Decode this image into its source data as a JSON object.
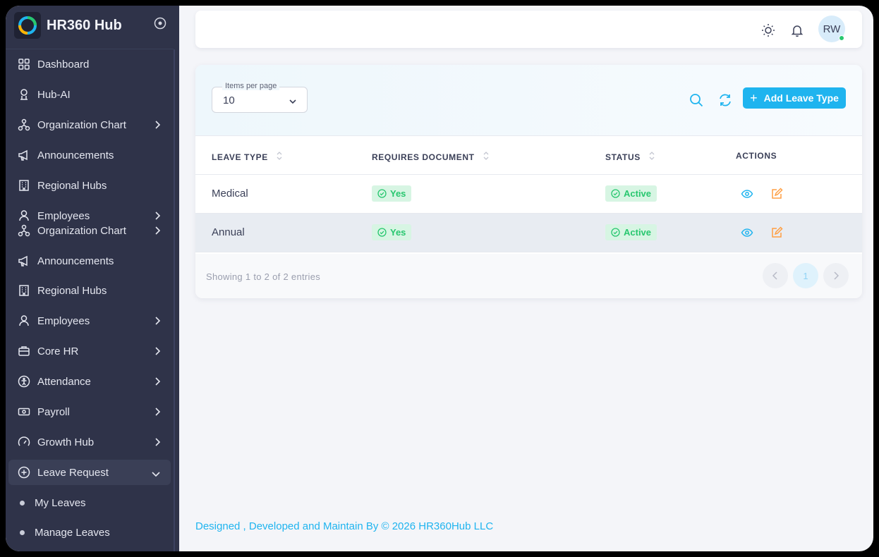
{
  "brand": {
    "name": "HR360 Hub"
  },
  "sidebar": {
    "items": [
      {
        "label": "Dashboard",
        "icon": "dashboard-icon"
      },
      {
        "label": "Hub-AI",
        "icon": "robot-icon"
      },
      {
        "label": "Organization Chart",
        "icon": "org-chart-icon",
        "chevron": "right"
      },
      {
        "label": "Announcements",
        "icon": "megaphone-icon"
      },
      {
        "label": "Regional Hubs",
        "icon": "building-icon"
      },
      {
        "label": "Employees",
        "icon": "user-icon",
        "chevron": "right"
      },
      {
        "label": "Organization Chart",
        "icon": "org-chart-icon",
        "chevron": "right"
      },
      {
        "label": "Announcements",
        "icon": "megaphone-icon"
      },
      {
        "label": "Regional Hubs",
        "icon": "building-icon"
      },
      {
        "label": "Employees",
        "icon": "user-icon",
        "chevron": "right"
      },
      {
        "label": "Core HR",
        "icon": "briefcase-icon",
        "chevron": "right"
      },
      {
        "label": "Attendance",
        "icon": "accessibility-icon",
        "chevron": "right"
      },
      {
        "label": "Payroll",
        "icon": "cash-icon",
        "chevron": "right"
      },
      {
        "label": "Growth Hub",
        "icon": "gauge-icon",
        "chevron": "right"
      },
      {
        "label": "Leave Request",
        "icon": "plus-circle-icon",
        "chevron": "down",
        "active": true
      }
    ],
    "subitems": [
      {
        "label": "My Leaves"
      },
      {
        "label": "Manage Leaves"
      }
    ]
  },
  "topbar": {
    "avatar_initials": "RW"
  },
  "toolbar": {
    "items_per_page_label": "Items per page",
    "items_per_page_value": "10",
    "add_button_label": "Add Leave Type"
  },
  "table": {
    "columns": [
      "LEAVE TYPE",
      "REQUIRES DOCUMENT",
      "STATUS",
      "ACTIONS"
    ],
    "rows": [
      {
        "leave_type": "Medical",
        "requires_document": "Yes",
        "status": "Active"
      },
      {
        "leave_type": "Annual",
        "requires_document": "Yes",
        "status": "Active"
      }
    ]
  },
  "pagination": {
    "summary": "Showing 1 to 2 of 2 entries",
    "current_page": "1"
  },
  "footer": {
    "copyright": "Designed , Developed and Maintain By © 2026 HR360Hub LLC"
  },
  "colors": {
    "accent": "#1fb4ef",
    "sidebar": "#2f3349",
    "success": "#28c76f",
    "warning": "#ff9f43"
  }
}
